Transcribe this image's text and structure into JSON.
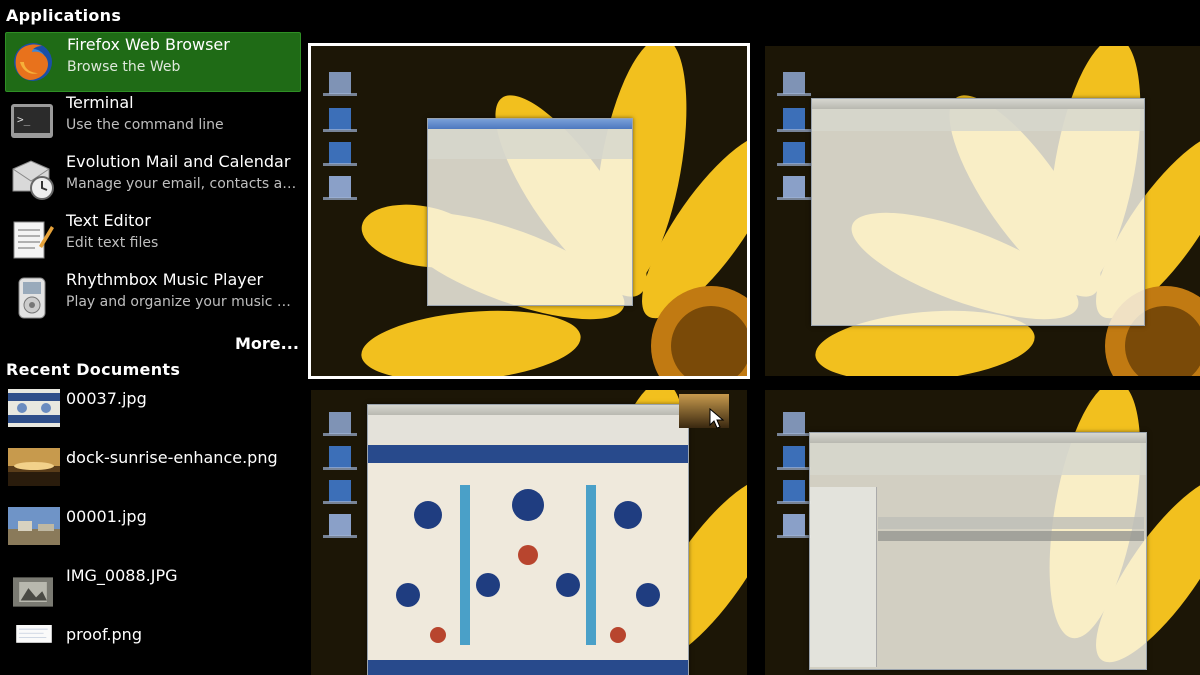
{
  "applications": {
    "heading": "Applications",
    "items": [
      {
        "name": "Firefox Web Browser",
        "desc": "Browse the Web",
        "icon": "firefox-icon",
        "selected": true
      },
      {
        "name": "Terminal",
        "desc": "Use the command line",
        "icon": "terminal-icon",
        "selected": false
      },
      {
        "name": "Evolution Mail and Calendar",
        "desc": "Manage your email, contacts a…",
        "icon": "mail-clock-icon",
        "selected": false
      },
      {
        "name": "Text Editor",
        "desc": "Edit text files",
        "icon": "text-editor-icon",
        "selected": false
      },
      {
        "name": "Rhythmbox Music Player",
        "desc": "Play and organize your music …",
        "icon": "music-player-icon",
        "selected": false
      }
    ],
    "more_label": "More..."
  },
  "recent": {
    "heading": "Recent Documents",
    "items": [
      {
        "name": "00037.jpg"
      },
      {
        "name": "dock-sunrise-enhance.png"
      },
      {
        "name": "00001.jpg"
      },
      {
        "name": "IMG_0088.JPG"
      },
      {
        "name": "proof.png"
      }
    ]
  },
  "colors": {
    "selection": "#1f6b16",
    "wallpaper_petal": "#f2c01e",
    "wallpaper_bg": "#1c1606"
  }
}
